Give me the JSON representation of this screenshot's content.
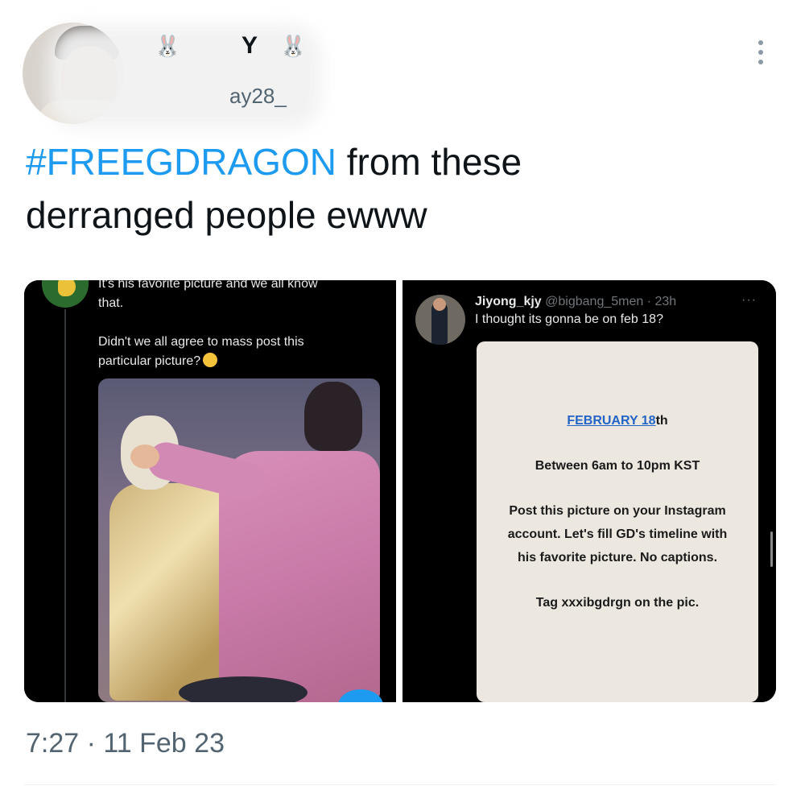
{
  "author": {
    "name_visible": "Y",
    "handle_fragment": "ay28_",
    "name_decorations": [
      "🐰",
      "🐰"
    ]
  },
  "header": {
    "more_icon": "more-dots-vertical-icon"
  },
  "tweet": {
    "hashtag": "#FREEGDRAGON",
    "text_after_hashtag": " from these",
    "text_line2": "derranged people ewww",
    "timestamp": "7:27 · 11 Feb 23"
  },
  "media_left": {
    "line1": "It's his favorite picture and we all know",
    "line2": "that.",
    "line3": "Didn't we all agree to mass post this",
    "line4": "particular picture?"
  },
  "media_right": {
    "display_name": "Jiyong_kjy",
    "meta": " @bigbang_5men · 23h",
    "more": "···",
    "reply": "I thought its gonna be on feb 18?",
    "note": {
      "date_link": "FEBRUARY 18",
      "date_suffix": "th",
      "time": "Between 6am to 10pm KST",
      "instr1": "Post this picture on your Instagram",
      "instr2": "account. Let's fill GD's timeline with",
      "instr3": "his favorite picture. No captions.",
      "tag": "Tag xxxibgdrgn on the pic."
    }
  }
}
